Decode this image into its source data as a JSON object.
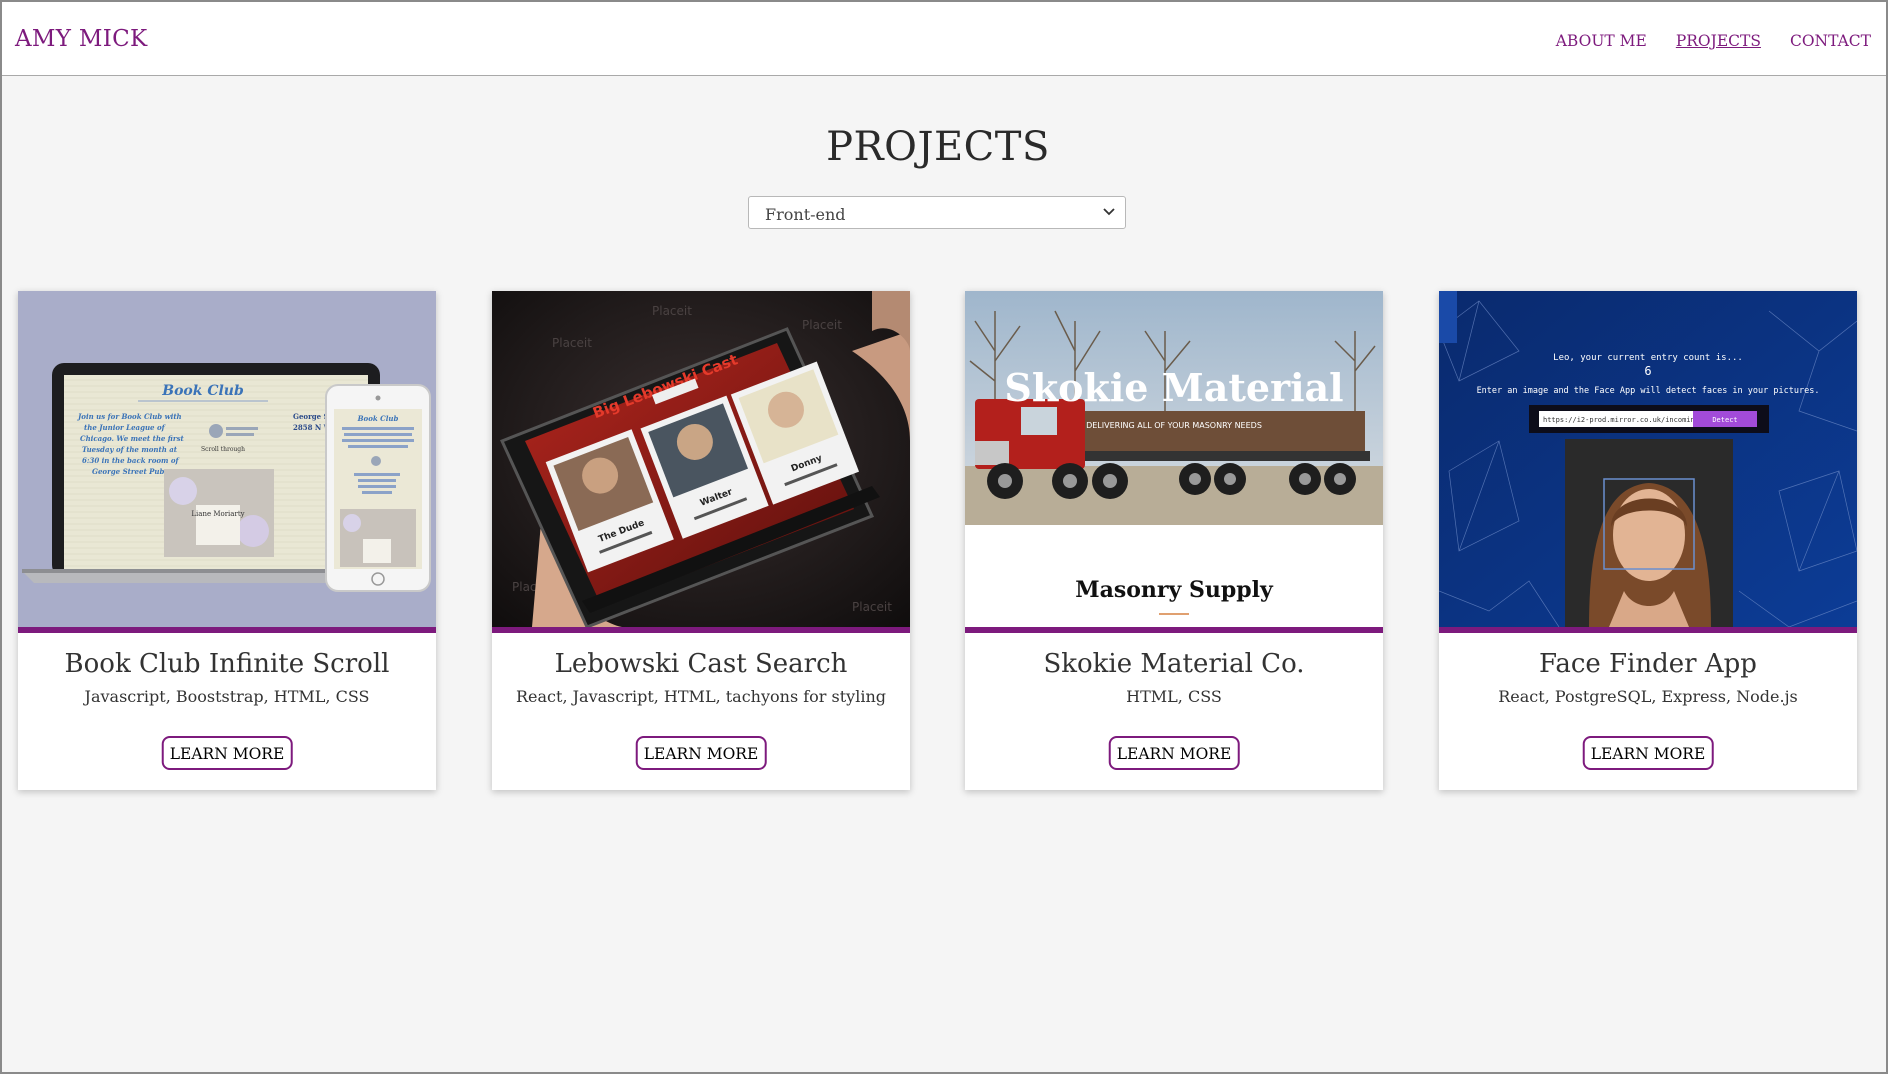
{
  "header": {
    "brand": "AMY MICK",
    "nav": [
      "ABOUT ME",
      "PROJECTS",
      "CONTACT"
    ],
    "active": "PROJECTS"
  },
  "page": {
    "title": "PROJECTS",
    "filter": {
      "selected": "Front-end"
    }
  },
  "colors": {
    "accent": "#7d1a7d",
    "background": "#f5f5f5"
  },
  "projects": [
    {
      "title": "Book Club Infinite Scroll",
      "tech": "Javascript, Booststrap, HTML, CSS",
      "button": "LEARN MORE",
      "image": {
        "heading": "Book Club",
        "text_left": "Join us for Book Club with the Junior League of Chicago. We meet the first Tuesday of the month at 6:30 in the back room of George Street Pub.",
        "text_right_top": "George S",
        "text_right_bottom": "2858 N W",
        "phone_heading": "Book Club",
        "scroll_label": "Scroll through",
        "book_title": "Liane Moriarty"
      }
    },
    {
      "title": "Lebowski Cast Search",
      "tech": "React, Javascript, HTML, tachyons for styling",
      "button": "LEARN MORE",
      "image": {
        "heading": "Big Lebowski Cast",
        "cards": [
          "The Dude",
          "Walter",
          "Donny"
        ],
        "watermark": "Placeit"
      }
    },
    {
      "title": "Skokie Material Co.",
      "tech": "HTML, CSS",
      "button": "LEARN MORE",
      "image": {
        "heading": "Skokie Material",
        "subheading": "DELIVERING ALL OF YOUR MASONRY NEEDS",
        "footer_text": "Masonry Supply"
      }
    },
    {
      "title": "Face Finder App",
      "tech": "React, PostgreSQL, Express, Node.js",
      "button": "LEARN MORE",
      "image": {
        "line1": "Leo, your current entry count is...",
        "count": "6",
        "line2": "Enter an image and the Face App will detect faces in your pictures.",
        "input": "https://i2-prod.mirror.co.uk/incomin",
        "button": "Detect"
      }
    }
  ]
}
